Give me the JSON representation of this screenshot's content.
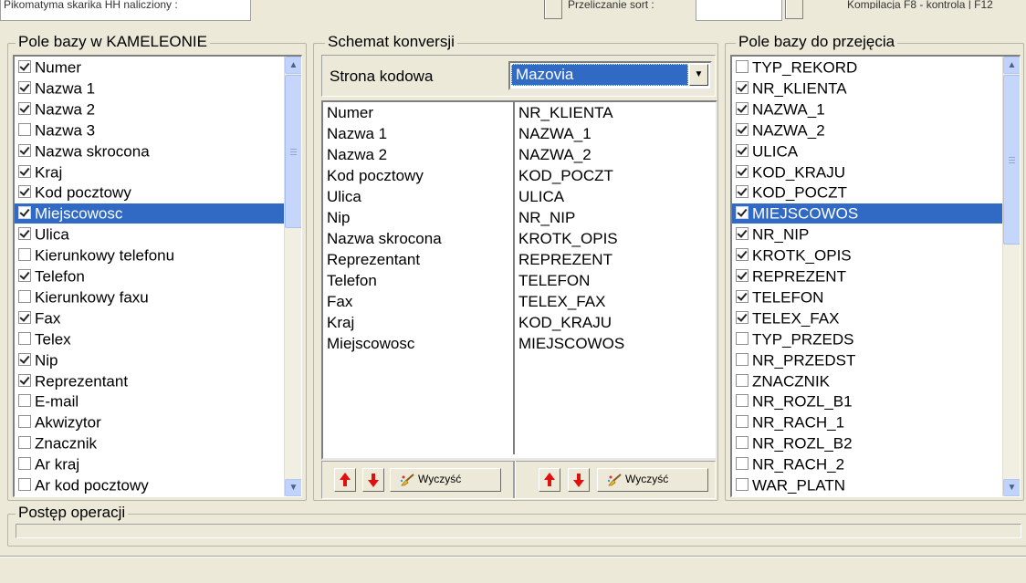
{
  "top": {
    "field1": "Pikomatyma skarika HH nalicziony :",
    "label2": "Przeliczanie sort :",
    "label3": "Kompilacja F8 - kontrola | F12"
  },
  "left": {
    "title": "Pole  bazy w KAMELEONIE",
    "items": [
      {
        "label": "Numer",
        "checked": true
      },
      {
        "label": "Nazwa 1",
        "checked": true
      },
      {
        "label": "Nazwa 2",
        "checked": true
      },
      {
        "label": "Nazwa 3",
        "checked": false
      },
      {
        "label": "Nazwa skrocona",
        "checked": true
      },
      {
        "label": "Kraj",
        "checked": true
      },
      {
        "label": "Kod pocztowy",
        "checked": true
      },
      {
        "label": "Miejscowosc",
        "checked": true,
        "selected": true
      },
      {
        "label": "Ulica",
        "checked": true
      },
      {
        "label": "Kierunkowy telefonu",
        "checked": false
      },
      {
        "label": "Telefon",
        "checked": true
      },
      {
        "label": "Kierunkowy faxu",
        "checked": false
      },
      {
        "label": "Fax",
        "checked": true
      },
      {
        "label": "Telex",
        "checked": false
      },
      {
        "label": "Nip",
        "checked": true
      },
      {
        "label": "Reprezentant",
        "checked": true
      },
      {
        "label": "E-mail",
        "checked": false
      },
      {
        "label": "Akwizytor",
        "checked": false
      },
      {
        "label": "Znacznik",
        "checked": false
      },
      {
        "label": "Ar kraj",
        "checked": false
      },
      {
        "label": "Ar kod pocztowy",
        "checked": false
      }
    ]
  },
  "middle": {
    "title": "Schemat konversji",
    "codepage_label": "Strona kodowa",
    "codepage_value": "Mazovia",
    "source_fields": [
      "Numer",
      "Nazwa 1",
      "Nazwa 2",
      "Kod pocztowy",
      "Ulica",
      "Nip",
      "Nazwa skrocona",
      "Reprezentant",
      "Telefon",
      "Fax",
      "Kraj",
      "Miejscowosc"
    ],
    "target_fields": [
      "NR_KLIENTA",
      "NAZWA_1",
      "NAZWA_2",
      "KOD_POCZT",
      "ULICA",
      "NR_NIP",
      "KROTK_OPIS",
      "REPREZENT",
      "TELEFON",
      "TELEX_FAX",
      "KOD_KRAJU",
      "MIEJSCOWOS"
    ],
    "clear_label": "Wyczyść"
  },
  "right": {
    "title": "Pole  bazy do przejęcia",
    "items": [
      {
        "label": "TYP_REKORD",
        "checked": false
      },
      {
        "label": "NR_KLIENTA",
        "checked": true
      },
      {
        "label": "NAZWA_1",
        "checked": true
      },
      {
        "label": "NAZWA_2",
        "checked": true
      },
      {
        "label": "ULICA",
        "checked": true
      },
      {
        "label": "KOD_KRAJU",
        "checked": true
      },
      {
        "label": "KOD_POCZT",
        "checked": true
      },
      {
        "label": "MIEJSCOWOS",
        "checked": true,
        "selected": true
      },
      {
        "label": "NR_NIP",
        "checked": true
      },
      {
        "label": "KROTK_OPIS",
        "checked": true
      },
      {
        "label": "REPREZENT",
        "checked": true
      },
      {
        "label": "TELEFON",
        "checked": true
      },
      {
        "label": "TELEX_FAX",
        "checked": true
      },
      {
        "label": "TYP_PRZEDS",
        "checked": false
      },
      {
        "label": "NR_PRZEDST",
        "checked": false
      },
      {
        "label": "ZNACZNIK",
        "checked": false
      },
      {
        "label": "NR_ROZL_B1",
        "checked": false
      },
      {
        "label": "NR_RACH_1",
        "checked": false
      },
      {
        "label": "NR_ROZL_B2",
        "checked": false
      },
      {
        "label": "NR_RACH_2",
        "checked": false
      },
      {
        "label": "WAR_PLATN",
        "checked": false
      }
    ]
  },
  "progress": {
    "title": "Postęp operacji",
    "value_percent": 0
  },
  "colors": {
    "selection": "#316ac5",
    "window_bg": "#ece9d8",
    "arrow": "#e01010"
  }
}
